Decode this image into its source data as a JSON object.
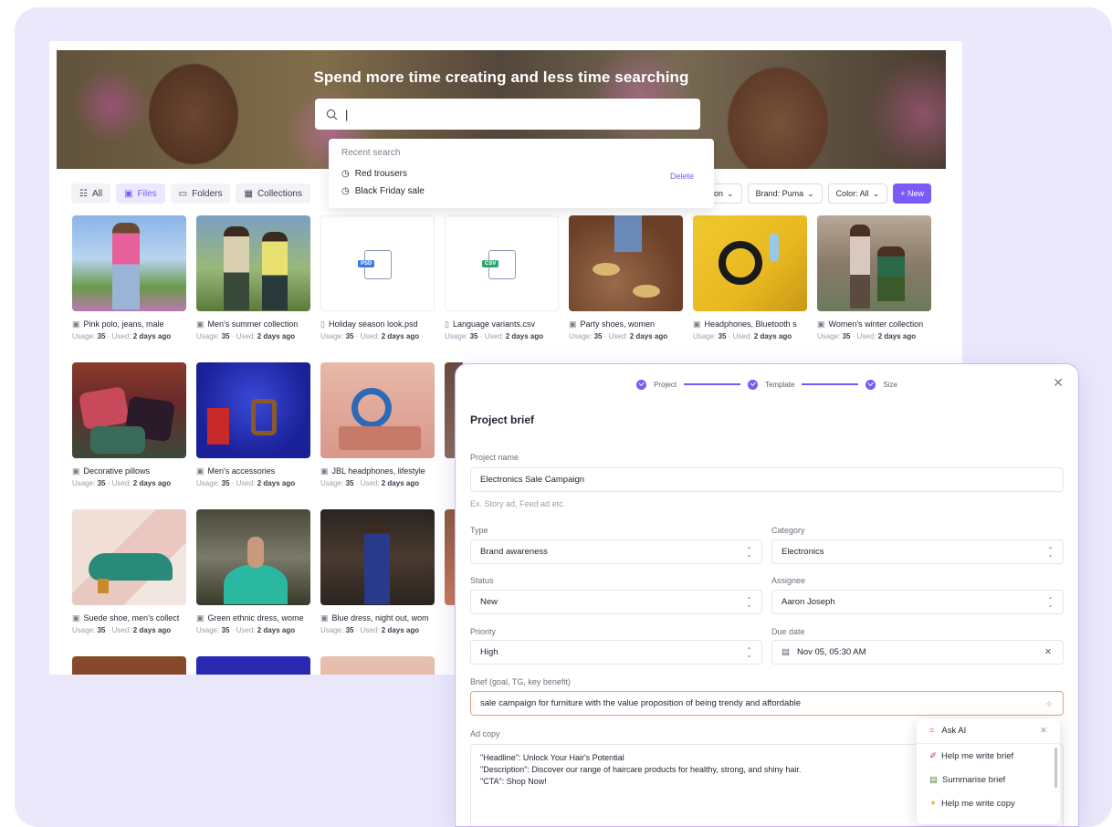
{
  "hero": {
    "title": "Spend more time creating and less time searching"
  },
  "search": {
    "value": "|"
  },
  "recent": {
    "heading": "Recent search",
    "delete": "Delete",
    "items": [
      "Red trousers",
      "Black Friday sale"
    ]
  },
  "tabs": [
    {
      "label": "All",
      "icon": "grid-icon"
    },
    {
      "label": "Files",
      "icon": "image-icon"
    },
    {
      "label": "Folders",
      "icon": "folder-icon"
    },
    {
      "label": "Collections",
      "icon": "collection-icon"
    }
  ],
  "filters": {
    "type": "ashion",
    "brand": "Brand: Puma",
    "color": "Color: All",
    "new": "+ New"
  },
  "assets": [
    {
      "name": "Pink polo, jeans, male",
      "usage": "35",
      "used": "2 days ago",
      "kind": "image"
    },
    {
      "name": "Men's summer collection",
      "usage": "35",
      "used": "2 days ago",
      "kind": "image"
    },
    {
      "name": "Holiday season look.psd",
      "usage": "35",
      "used": "2 days ago",
      "kind": "file",
      "ext": "PSD"
    },
    {
      "name": "Language variants.csv",
      "usage": "35",
      "used": "2 days ago",
      "kind": "file",
      "ext": "CSV"
    },
    {
      "name": "Party shoes, women",
      "usage": "35",
      "used": "2 days ago",
      "kind": "image"
    },
    {
      "name": "Headphones, Bluetooth s",
      "usage": "35",
      "used": "2 days ago",
      "kind": "image"
    },
    {
      "name": "Women's winter collection",
      "usage": "35",
      "used": "2 days ago",
      "kind": "image"
    },
    {
      "name": "Decorative pillows",
      "usage": "35",
      "used": "2 days ago",
      "kind": "image"
    },
    {
      "name": "Men's accessories",
      "usage": "35",
      "used": "2 days ago",
      "kind": "image"
    },
    {
      "name": "JBL headphones, lifestyle",
      "usage": "35",
      "used": "2 days ago",
      "kind": "image"
    },
    {
      "name": "Suede shoe, men's collect",
      "usage": "35",
      "used": "2 days ago",
      "kind": "image"
    },
    {
      "name": "Green ethnic dress, wome",
      "usage": "35",
      "used": "2 days ago",
      "kind": "image"
    },
    {
      "name": "Blue dress, night out, wom",
      "usage": "35",
      "used": "2 days ago",
      "kind": "image"
    }
  ],
  "meta_labels": {
    "usage": "Usage:",
    "used": "Used:"
  },
  "modal": {
    "steps": [
      "Project",
      "Template",
      "Size"
    ],
    "title": "Project brief",
    "project_name": {
      "label": "Project name",
      "value": "Electronics Sale Campaign",
      "hint": "Ex. Story ad, Feed ad etc."
    },
    "type": {
      "label": "Type",
      "value": "Brand awareness"
    },
    "category": {
      "label": "Category",
      "value": "Electronics"
    },
    "status": {
      "label": "Status",
      "value": "New"
    },
    "assignee": {
      "label": "Assignee",
      "value": "Aaron Joseph"
    },
    "priority": {
      "label": "Priority",
      "value": "High"
    },
    "due_date": {
      "label": "Due date",
      "value": "Nov 05, 05:30 AM"
    },
    "brief": {
      "label": "Brief (goal, TG, key benefit)",
      "value": "sale campaign for furniture with the value proposition of being trendy and affordable"
    },
    "ad_copy": {
      "label": "Ad copy",
      "lines": [
        "\"Headline\": Unlock Your Hair's Potential",
        "\"Description\": Discover our range of haircare products for healthy, strong, and shiny hair.",
        "\"CTA\": Shop Now!"
      ]
    }
  },
  "ask_ai": {
    "title": "Ask AI",
    "items": [
      "Help me write brief",
      "Summarise brief",
      "Help me write copy"
    ]
  }
}
